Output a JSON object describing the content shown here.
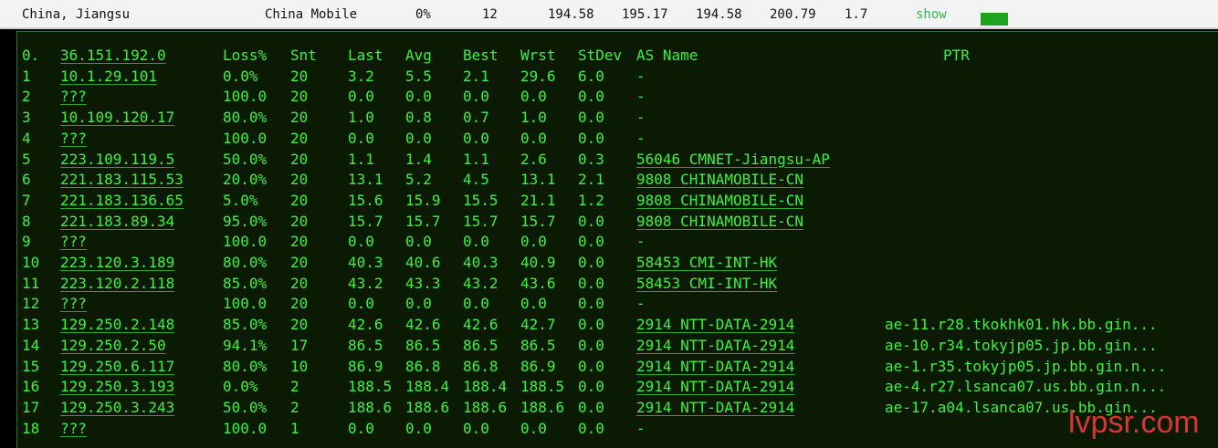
{
  "summary": {
    "location": "China, Jiangsu",
    "isp": "China Mobile",
    "loss": "0%",
    "sent": "12",
    "last": "194.58",
    "avg": "195.17",
    "best": "194.58",
    "worst": "200.79",
    "stdev": "1.7",
    "show_label": "show",
    "bar_color": "#1fa31f"
  },
  "headers": {
    "num": "0.",
    "host": "36.151.192.0",
    "loss": "Loss%",
    "snt": "Snt",
    "last": "Last",
    "avg": "Avg",
    "best": "Best",
    "wrst": "Wrst",
    "stdev": "StDev",
    "as_name": "AS Name",
    "ptr": "PTR"
  },
  "hops": [
    {
      "num": "1",
      "host": "10.1.29.101",
      "loss": "0.0%",
      "snt": "20",
      "last": "3.2",
      "avg": "5.5",
      "best": "2.1",
      "wrst": "29.6",
      "stdev": "6.0",
      "as": "-",
      "ptr": ""
    },
    {
      "num": "2",
      "host": "???",
      "loss": "100.0",
      "snt": "20",
      "last": "0.0",
      "avg": "0.0",
      "best": "0.0",
      "wrst": "0.0",
      "stdev": "0.0",
      "as": "-",
      "ptr": ""
    },
    {
      "num": "3",
      "host": "10.109.120.17",
      "loss": "80.0%",
      "snt": "20",
      "last": "1.0",
      "avg": "0.8",
      "best": "0.7",
      "wrst": "1.0",
      "stdev": "0.0",
      "as": "-",
      "ptr": ""
    },
    {
      "num": "4",
      "host": "???",
      "loss": "100.0",
      "snt": "20",
      "last": "0.0",
      "avg": "0.0",
      "best": "0.0",
      "wrst": "0.0",
      "stdev": "0.0",
      "as": "-",
      "ptr": ""
    },
    {
      "num": "5",
      "host": "223.109.119.5",
      "loss": "50.0%",
      "snt": "20",
      "last": "1.1",
      "avg": "1.4",
      "best": "1.1",
      "wrst": "2.6",
      "stdev": "0.3",
      "as": "56046  CMNET-Jiangsu-AP",
      "ptr": ""
    },
    {
      "num": "6",
      "host": "221.183.115.53",
      "loss": "20.0%",
      "snt": "20",
      "last": "13.1",
      "avg": "5.2",
      "best": "4.5",
      "wrst": "13.1",
      "stdev": "2.1",
      "as": "9808  CHINAMOBILE-CN",
      "ptr": ""
    },
    {
      "num": "7",
      "host": "221.183.136.65",
      "loss": "5.0%",
      "snt": "20",
      "last": "15.6",
      "avg": "15.9",
      "best": "15.5",
      "wrst": "21.1",
      "stdev": "1.2",
      "as": "9808  CHINAMOBILE-CN",
      "ptr": ""
    },
    {
      "num": "8",
      "host": "221.183.89.34",
      "loss": "95.0%",
      "snt": "20",
      "last": "15.7",
      "avg": "15.7",
      "best": "15.7",
      "wrst": "15.7",
      "stdev": "0.0",
      "as": "9808  CHINAMOBILE-CN",
      "ptr": ""
    },
    {
      "num": "9",
      "host": "???",
      "loss": "100.0",
      "snt": "20",
      "last": "0.0",
      "avg": "0.0",
      "best": "0.0",
      "wrst": "0.0",
      "stdev": "0.0",
      "as": "-",
      "ptr": ""
    },
    {
      "num": "10",
      "host": "223.120.3.189",
      "loss": "80.0%",
      "snt": "20",
      "last": "40.3",
      "avg": "40.6",
      "best": "40.3",
      "wrst": "40.9",
      "stdev": "0.0",
      "as": "58453  CMI-INT-HK",
      "ptr": ""
    },
    {
      "num": "11",
      "host": "223.120.2.118",
      "loss": "85.0%",
      "snt": "20",
      "last": "43.2",
      "avg": "43.3",
      "best": "43.2",
      "wrst": "43.6",
      "stdev": "0.0",
      "as": "58453  CMI-INT-HK",
      "ptr": ""
    },
    {
      "num": "12",
      "host": "???",
      "loss": "100.0",
      "snt": "20",
      "last": "0.0",
      "avg": "0.0",
      "best": "0.0",
      "wrst": "0.0",
      "stdev": "0.0",
      "as": "-",
      "ptr": ""
    },
    {
      "num": "13",
      "host": "129.250.2.148",
      "loss": "85.0%",
      "snt": "20",
      "last": "42.6",
      "avg": "42.6",
      "best": "42.6",
      "wrst": "42.7",
      "stdev": "0.0",
      "as": "2914  NTT-DATA-2914",
      "ptr": "ae-11.r28.tkokhk01.hk.bb.gin..."
    },
    {
      "num": "14",
      "host": "129.250.2.50",
      "loss": "94.1%",
      "snt": "17",
      "last": "86.5",
      "avg": "86.5",
      "best": "86.5",
      "wrst": "86.5",
      "stdev": "0.0",
      "as": "2914  NTT-DATA-2914",
      "ptr": "ae-10.r34.tokyjp05.jp.bb.gin..."
    },
    {
      "num": "15",
      "host": "129.250.6.117",
      "loss": "80.0%",
      "snt": "10",
      "last": "86.9",
      "avg": "86.8",
      "best": "86.8",
      "wrst": "86.9",
      "stdev": "0.0",
      "as": "2914  NTT-DATA-2914",
      "ptr": "ae-1.r35.tokyjp05.jp.bb.gin.n..."
    },
    {
      "num": "16",
      "host": "129.250.3.193",
      "loss": "0.0%",
      "snt": "2",
      "last": "188.5",
      "avg": "188.4",
      "best": "188.4",
      "wrst": "188.5",
      "stdev": "0.0",
      "as": "2914  NTT-DATA-2914",
      "ptr": "ae-4.r27.lsanca07.us.bb.gin.n..."
    },
    {
      "num": "17",
      "host": "129.250.3.243",
      "loss": "50.0%",
      "snt": "2",
      "last": "188.6",
      "avg": "188.6",
      "best": "188.6",
      "wrst": "188.6",
      "stdev": "0.0",
      "as": "2914  NTT-DATA-2914",
      "ptr": "ae-17.a04.lsanca07.us.bb.gin..."
    },
    {
      "num": "18",
      "host": "???",
      "loss": "100.0",
      "snt": "1",
      "last": "0.0",
      "avg": "0.0",
      "best": "0.0",
      "wrst": "0.0",
      "stdev": "0.0",
      "as": "-",
      "ptr": ""
    }
  ],
  "watermark": "lvpsr.com"
}
